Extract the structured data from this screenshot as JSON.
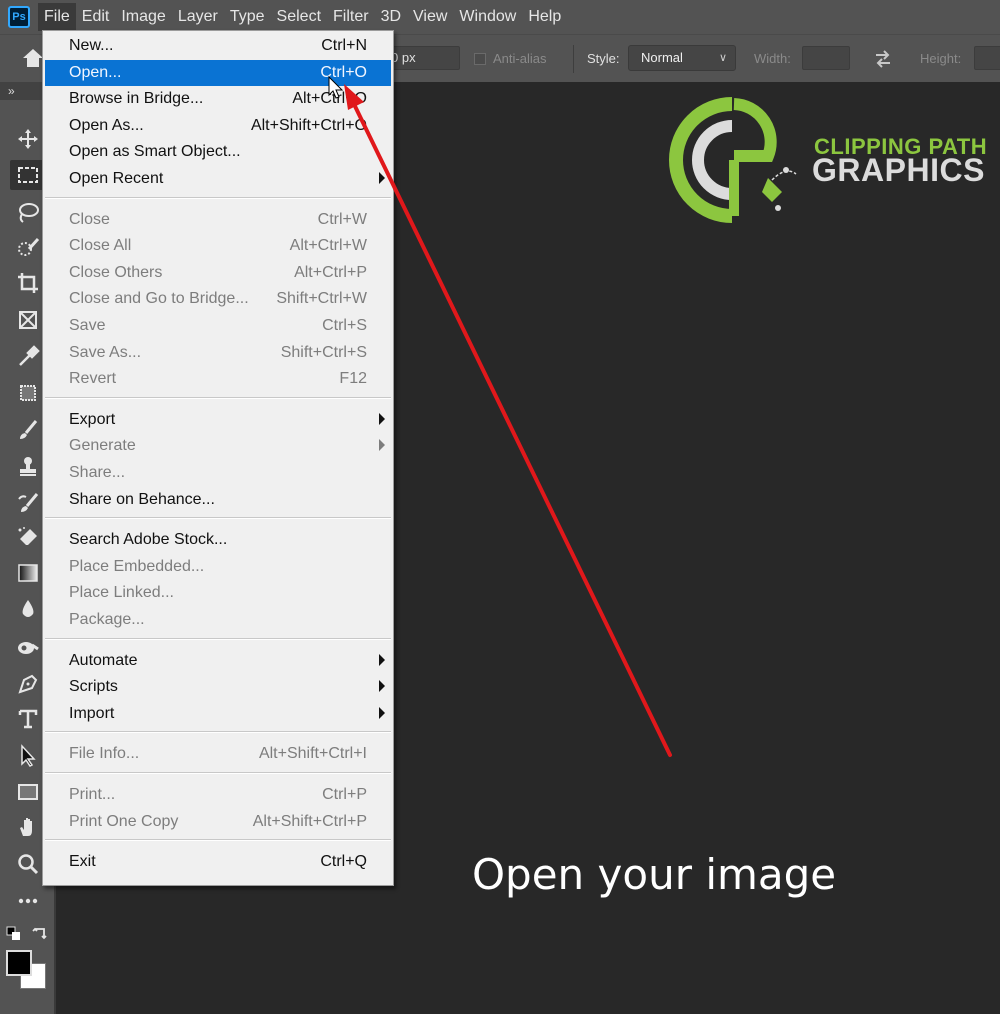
{
  "app": {
    "logo_text": "Ps"
  },
  "menubar": {
    "items": [
      "File",
      "Edit",
      "Image",
      "Layer",
      "Type",
      "Select",
      "Filter",
      "3D",
      "View",
      "Window",
      "Help"
    ],
    "active": "File"
  },
  "options": {
    "feather_value": "0 px",
    "anti_alias_label": "Anti-alias",
    "style_label": "Style:",
    "style_value": "Normal",
    "width_label": "Width:",
    "width_value": "",
    "height_label": "Height:",
    "height_value": ""
  },
  "toolbar": {
    "collapse_label": "»",
    "tools": [
      "move-tool",
      "rectangular-marquee-tool",
      "lasso-tool",
      "quick-selection-tool",
      "crop-tool",
      "frame-tool",
      "eyedropper-tool",
      "spot-healing-tool",
      "brush-tool",
      "clone-stamp-tool",
      "history-brush-tool",
      "eraser-tool",
      "gradient-tool",
      "blur-tool",
      "dodge-tool",
      "pen-tool",
      "type-tool",
      "path-selection-tool",
      "rectangle-tool",
      "hand-tool",
      "zoom-tool",
      "edit-toolbar"
    ],
    "selected_tool": "rectangular-marquee-tool",
    "foreground_color": "#000000",
    "background_color": "#ffffff"
  },
  "file_menu": {
    "groups": [
      [
        {
          "label": "New...",
          "shortcut": "Ctrl+N",
          "enabled": true
        },
        {
          "label": "Open...",
          "shortcut": "Ctrl+O",
          "enabled": true,
          "highlighted": true
        },
        {
          "label": "Browse in Bridge...",
          "shortcut": "Alt+Ctrl+O",
          "enabled": true
        },
        {
          "label": "Open As...",
          "shortcut": "Alt+Shift+Ctrl+O",
          "enabled": true
        },
        {
          "label": "Open as Smart Object...",
          "shortcut": "",
          "enabled": true
        },
        {
          "label": "Open Recent",
          "shortcut": "",
          "enabled": true,
          "submenu": true
        }
      ],
      [
        {
          "label": "Close",
          "shortcut": "Ctrl+W",
          "enabled": false
        },
        {
          "label": "Close All",
          "shortcut": "Alt+Ctrl+W",
          "enabled": false
        },
        {
          "label": "Close Others",
          "shortcut": "Alt+Ctrl+P",
          "enabled": false
        },
        {
          "label": "Close and Go to Bridge...",
          "shortcut": "Shift+Ctrl+W",
          "enabled": false
        },
        {
          "label": "Save",
          "shortcut": "Ctrl+S",
          "enabled": false
        },
        {
          "label": "Save As...",
          "shortcut": "Shift+Ctrl+S",
          "enabled": false
        },
        {
          "label": "Revert",
          "shortcut": "F12",
          "enabled": false
        }
      ],
      [
        {
          "label": "Export",
          "shortcut": "",
          "enabled": true,
          "submenu": true
        },
        {
          "label": "Generate",
          "shortcut": "",
          "enabled": false,
          "submenu": true
        },
        {
          "label": "Share...",
          "shortcut": "",
          "enabled": false
        },
        {
          "label": "Share on Behance...",
          "shortcut": "",
          "enabled": true
        }
      ],
      [
        {
          "label": "Search Adobe Stock...",
          "shortcut": "",
          "enabled": true
        },
        {
          "label": "Place Embedded...",
          "shortcut": "",
          "enabled": false
        },
        {
          "label": "Place Linked...",
          "shortcut": "",
          "enabled": false
        },
        {
          "label": "Package...",
          "shortcut": "",
          "enabled": false
        }
      ],
      [
        {
          "label": "Automate",
          "shortcut": "",
          "enabled": true,
          "submenu": true
        },
        {
          "label": "Scripts",
          "shortcut": "",
          "enabled": true,
          "submenu": true
        },
        {
          "label": "Import",
          "shortcut": "",
          "enabled": true,
          "submenu": true
        }
      ],
      [
        {
          "label": "File Info...",
          "shortcut": "Alt+Shift+Ctrl+I",
          "enabled": false
        }
      ],
      [
        {
          "label": "Print...",
          "shortcut": "Ctrl+P",
          "enabled": false
        },
        {
          "label": "Print One Copy",
          "shortcut": "Alt+Shift+Ctrl+P",
          "enabled": false
        }
      ],
      [
        {
          "label": "Exit",
          "shortcut": "Ctrl+Q",
          "enabled": true
        }
      ]
    ]
  },
  "branding": {
    "line1": "CLIPPING PATH",
    "line2": "GRAPHICS",
    "green": "#8cc63f",
    "gray": "#dcdcdc"
  },
  "caption": "Open your image",
  "annotation": {
    "arrow_color": "#e0181b"
  },
  "colors": {
    "menu_highlight": "#0a73d3",
    "panel": "#535353",
    "canvas": "#282828"
  }
}
